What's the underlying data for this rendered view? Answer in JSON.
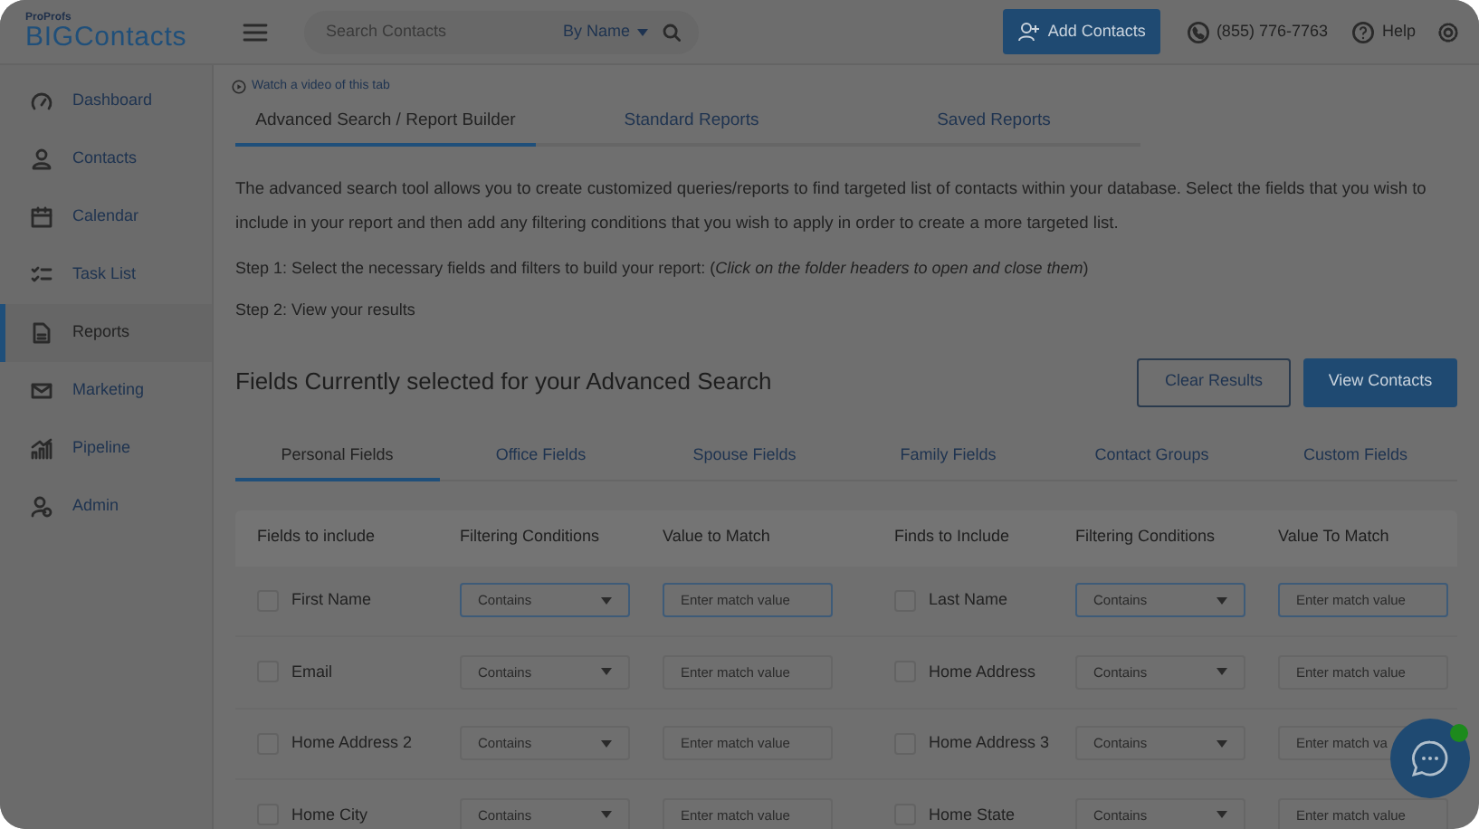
{
  "header": {
    "logo_small": "ProProfs",
    "logo_big": "BIGContacts",
    "search_placeholder": "Search Contacts",
    "search_mode": "By Name",
    "add_button": "Add Contacts",
    "phone": "(855) 776-7763",
    "help": "Help"
  },
  "sidebar": {
    "items": [
      {
        "label": "Dashboard",
        "selected": false
      },
      {
        "label": "Contacts",
        "selected": false
      },
      {
        "label": "Calendar",
        "selected": false
      },
      {
        "label": "Task List",
        "selected": false
      },
      {
        "label": "Reports",
        "selected": true
      },
      {
        "label": "Marketing",
        "selected": false
      },
      {
        "label": "Pipeline",
        "selected": false
      },
      {
        "label": "Admin",
        "selected": false
      }
    ]
  },
  "video_link": "Watch a video of this tab",
  "tabs": [
    {
      "label": "Advanced Search / Report Builder",
      "selected": true
    },
    {
      "label": "Standard Reports",
      "selected": false
    },
    {
      "label": "Saved Reports",
      "selected": false
    }
  ],
  "description": "The advanced search tool allows you to create customized queries/reports to find targeted list of contacts within your database. Select the fields that you wish to include in your report and then add any filtering conditions that you wish to apply in order to create a more targeted list.",
  "steps": [
    "Step 1: Select the necessary fields and filters to build your report: (*Click on the folder headers to open and close them*)",
    "Step 2: View your results"
  ],
  "section_title": "Fields Currently selected for your Advanced Search",
  "buttons": {
    "clear": "Clear Results",
    "view": "View Contacts"
  },
  "field_tabs": [
    {
      "label": "Personal Fields",
      "selected": true
    },
    {
      "label": "Office Fields",
      "selected": false
    },
    {
      "label": "Spouse Fields",
      "selected": false
    },
    {
      "label": "Family Fields",
      "selected": false
    },
    {
      "label": "Contact Groups",
      "selected": false
    },
    {
      "label": "Custom Fields",
      "selected": false
    }
  ],
  "table": {
    "columns": [
      "Fields to include",
      "Filtering Conditions",
      "Value to Match",
      "Finds to Include",
      "Filtering Conditions",
      "Value To Match"
    ],
    "rows": [
      {
        "left": {
          "field": "First Name",
          "checked": false,
          "condition": "Contains",
          "placeholder": "Enter match value"
        },
        "right": {
          "field": "Last Name",
          "checked": false,
          "condition": "Contains",
          "placeholder": "Enter match value"
        },
        "focused": true
      },
      {
        "left": {
          "field": "Email",
          "checked": false,
          "condition": "Contains",
          "placeholder": "Enter match value"
        },
        "right": {
          "field": "Home Address",
          "checked": false,
          "condition": "Contains",
          "placeholder": "Enter match value"
        },
        "focused": false
      },
      {
        "left": {
          "field": "Home Address 2",
          "checked": false,
          "condition": "Contains",
          "placeholder": "Enter match value"
        },
        "right": {
          "field": "Home Address 3",
          "checked": false,
          "condition": "Contains",
          "placeholder": "Enter match va"
        },
        "focused": false
      },
      {
        "left": {
          "field": "Home City",
          "checked": false,
          "condition": "Contains",
          "placeholder": "Enter match value"
        },
        "right": {
          "field": "Home State",
          "checked": false,
          "condition": "Contains",
          "placeholder": "Enter match value"
        },
        "focused": false
      }
    ]
  }
}
